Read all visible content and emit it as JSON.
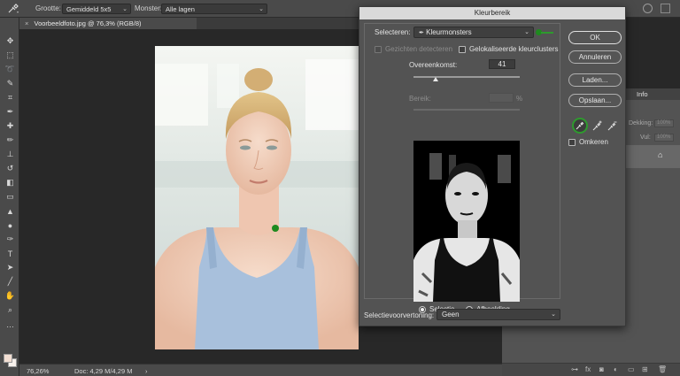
{
  "options_bar": {
    "size_label": "Grootte:",
    "size_value": "Gemiddeld 5x5",
    "sample_label": "Monster:",
    "sample_value": "Alle lagen"
  },
  "document_tab": {
    "title": "Voorbeeldfoto.jpg @ 76,3% (RGB/8)"
  },
  "status_bar": {
    "zoom": "76,26%",
    "doc_info": "Doc: 4,29 M/4,29 M"
  },
  "right_panel": {
    "tab_info": "Info",
    "opacity_label": "Dekking:",
    "opacity_value": "100%",
    "fill_label": "Vul:",
    "fill_value": "100%"
  },
  "dialog": {
    "title": "Kleurbereik",
    "select_label": "Selecteren:",
    "select_value": "Kleurmonsters",
    "detect_faces_label": "Gezichten detecteren",
    "localized_clusters_label": "Gelokaliseerde kleurclusters",
    "fuzziness_label": "Overeenkomst:",
    "fuzziness_value": "41",
    "fuzziness_fraction": 0.205,
    "range_label": "Bereik:",
    "range_unit": "%",
    "radio_selection": "Selectie",
    "radio_image": "Afbeelding",
    "preview_label": "Selectievoorvertoning:",
    "preview_value": "Geen",
    "buttons": {
      "ok": "OK",
      "cancel": "Annuleren",
      "load": "Laden...",
      "save": "Opslaan..."
    },
    "invert_label": "Omkeren"
  },
  "colors": {
    "accent_highlight": "#2e9a2e",
    "dialog_bg": "#535353",
    "panel_bg": "#4a4a4a"
  }
}
